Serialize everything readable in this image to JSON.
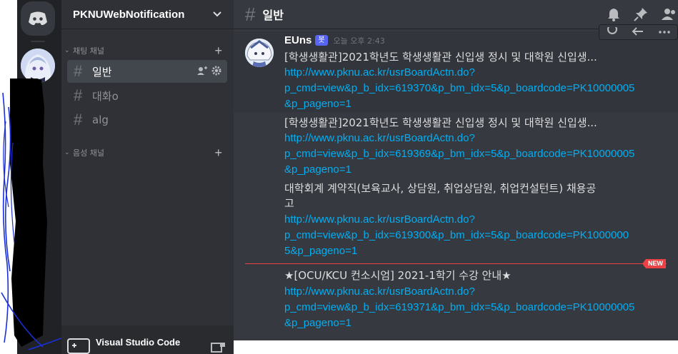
{
  "server": {
    "name": "PKNUWebNotification"
  },
  "sidebar": {
    "text_category": "채팅 채널",
    "voice_category": "음성 채널",
    "channels": [
      {
        "label": "일반"
      },
      {
        "label": "대화o"
      },
      {
        "label": "alg"
      }
    ]
  },
  "user_panel": {
    "activity": "Visual Studio Code"
  },
  "chat": {
    "channel_title": "일반",
    "author": "EUns",
    "bot_tag": "봇",
    "timestamp": "오늘 오후 2:43",
    "new_badge": "NEW",
    "posts": [
      {
        "title": "[학생생활관]2021학년도 학생생활관 신입생 정시 및 대학원 신입생...",
        "link_lines": [
          "http://www.pknu.ac.kr/usrBoardActn.do?",
          "p_cmd=view&p_b_idx=619370&p_bm_idx=5&p_boardcode=PK10000005",
          "&p_pageno=1"
        ]
      },
      {
        "title": "[학생생활관]2021학년도 학생생활관 신입생 정시 및 대학원 신입생...",
        "link_lines": [
          "http://www.pknu.ac.kr/usrBoardActn.do?",
          "p_cmd=view&p_b_idx=619369&p_bm_idx=5&p_boardcode=PK10000005",
          "&p_pageno=1"
        ]
      },
      {
        "title_lines": [
          "대학회계 계약직(보육교사, 상담원, 취업상담원, 취업컨설턴트) 채용공",
          "고"
        ],
        "link_lines": [
          "http://www.pknu.ac.kr/usrBoardActn.do?",
          "p_cmd=view&p_b_idx=619300&p_bm_idx=5&p_boardcode=PK1000000",
          "5&p_pageno=1"
        ]
      },
      {
        "title": "★[OCU/KCU 컨소시엄] 2021-1학기 수강 안내★",
        "link_lines": [
          "http://www.pknu.ac.kr/usrBoardActn.do?",
          "p_cmd=view&p_b_idx=619371&p_bm_idx=5&p_boardcode=PK10000005",
          "&p_pageno=1"
        ]
      }
    ]
  },
  "colors": {
    "accent": "#5865f2",
    "link": "#00aff4",
    "new_line": "#ed4245"
  }
}
